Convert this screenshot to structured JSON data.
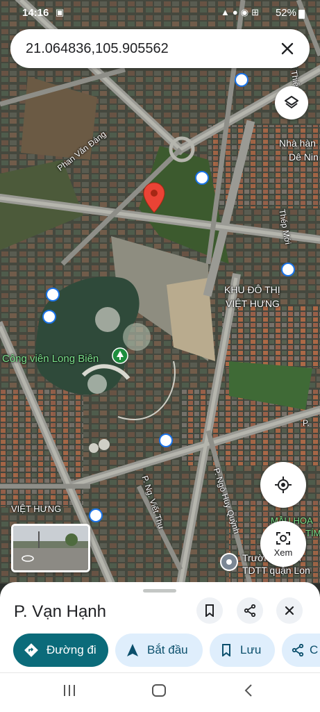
{
  "status_bar": {
    "time": "14:16",
    "battery": "52%"
  },
  "search": {
    "value": "21.064836,105.905562"
  },
  "map_labels": {
    "park": "Công viên Long Biên",
    "district_line1": "KHU ĐÔ THỊ",
    "district_line2": "VIỆT HƯNG",
    "street_phan_van_dang": "Phan Văn Đáng",
    "street_thep_moi": "Thép Mới",
    "street_ngo_huy_quynh": "P. Ngô Huy Quỳnh",
    "street_viet_thu": "P. Ng. Viết Thụ",
    "place_viet_hung": "VIỆT HƯNG",
    "poi_top_right_line1": "Nhà hàn",
    "poi_top_right_line2": "Dê Nin",
    "street_thien_ngo": "ui Thiện Ngọ",
    "poi_bottom_right_line1": "Trường ng kh",
    "poi_bottom_right_line2": "TDTT quận Lon",
    "poi_green_line1": "MẦU HOẠ",
    "poi_green_line2": "TÍM",
    "street_p_right": "P."
  },
  "controls": {
    "xem_label": "Xem"
  },
  "place_sheet": {
    "title": "P. Vạn Hạnh",
    "actions": [
      {
        "label": "Đường đi",
        "icon": "directions-icon"
      },
      {
        "label": "Bắt đầu",
        "icon": "navigation-arrow-icon"
      },
      {
        "label": "Lưu",
        "icon": "bookmark-icon"
      },
      {
        "label": "C",
        "icon": "share-icon"
      }
    ]
  },
  "colors": {
    "primary": "#0b6b7a",
    "chip": "#dfeefc",
    "pin": "#ea4335",
    "park_pin": "#1e8e3e"
  }
}
